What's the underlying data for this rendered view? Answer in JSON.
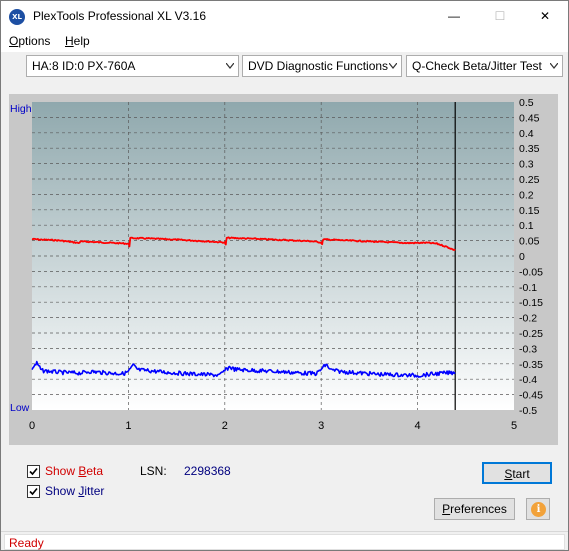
{
  "window": {
    "title": "PlexTools Professional XL V3.16",
    "icon_text": "XL",
    "minimize_glyph": "—",
    "maximize_glyph": "☐",
    "close_glyph": "✕"
  },
  "menu": {
    "options": {
      "accel": "O",
      "rest": "ptions"
    },
    "help": {
      "accel": "H",
      "rest": "elp"
    }
  },
  "toolbar": {
    "drive_select": "HA:8 ID:0  PX-760A",
    "function_select": "DVD Diagnostic Functions",
    "test_select": "Q-Check Beta/Jitter Test"
  },
  "chart_data": {
    "type": "line",
    "left_axis_labels": {
      "top": "High",
      "bottom": "Low"
    },
    "x": {
      "min": 0,
      "max": 5,
      "ticks": [
        "0",
        "1",
        "2",
        "3",
        "4",
        "5"
      ]
    },
    "y_right": {
      "min": -0.5,
      "max": 0.5,
      "ticks": [
        "0.5",
        "0.45",
        "0.4",
        "0.35",
        "0.3",
        "0.25",
        "0.2",
        "0.15",
        "0.1",
        "0.05",
        "0",
        "-0.05",
        "-0.1",
        "-0.15",
        "-0.2",
        "-0.25",
        "-0.3",
        "-0.35",
        "-0.4",
        "-0.45",
        "-0.5"
      ]
    },
    "grid": true,
    "end_marker_x": 4.39,
    "colors": {
      "beta": "#ff0000",
      "jitter": "#0000ff",
      "plot_top": "#8fa8ad",
      "plot_bottom": "#ffffff"
    },
    "series": [
      {
        "key": "beta",
        "x": [
          0,
          0.1,
          0.2,
          0.3,
          0.4,
          0.49,
          0.5,
          0.6,
          0.8,
          1.0,
          1.01,
          1.02,
          1.2,
          1.5,
          1.8,
          2.0,
          2.01,
          2.02,
          2.3,
          2.6,
          2.9,
          3.0,
          3.01,
          3.02,
          3.3,
          3.6,
          3.9,
          4.1,
          4.2,
          4.3,
          4.39
        ],
        "y": [
          0.055,
          0.053,
          0.052,
          0.05,
          0.046,
          0.042,
          0.047,
          0.046,
          0.043,
          0.04,
          0.032,
          0.058,
          0.057,
          0.053,
          0.048,
          0.044,
          0.036,
          0.059,
          0.056,
          0.052,
          0.048,
          0.044,
          0.038,
          0.054,
          0.05,
          0.046,
          0.042,
          0.043,
          0.04,
          0.03,
          0.018
        ]
      },
      {
        "key": "jitter",
        "x": [
          0,
          0.05,
          0.1,
          0.2,
          0.3,
          0.5,
          0.6,
          0.8,
          0.95,
          1.0,
          1.05,
          1.1,
          1.2,
          1.4,
          1.6,
          1.8,
          1.95,
          2.0,
          2.05,
          2.1,
          2.2,
          2.4,
          2.6,
          2.8,
          2.95,
          3.0,
          3.05,
          3.1,
          3.2,
          3.4,
          3.6,
          3.8,
          4.0,
          4.2,
          4.39
        ],
        "y": [
          -0.365,
          -0.348,
          -0.372,
          -0.375,
          -0.378,
          -0.38,
          -0.375,
          -0.38,
          -0.382,
          -0.375,
          -0.355,
          -0.37,
          -0.372,
          -0.378,
          -0.382,
          -0.385,
          -0.387,
          -0.372,
          -0.36,
          -0.368,
          -0.37,
          -0.373,
          -0.376,
          -0.38,
          -0.382,
          -0.368,
          -0.352,
          -0.37,
          -0.375,
          -0.38,
          -0.384,
          -0.386,
          -0.388,
          -0.382,
          -0.378
        ]
      }
    ]
  },
  "controls": {
    "show_beta": {
      "pre": "Show ",
      "accel": "B",
      "post": "eta",
      "checked": true,
      "color": "#d00000"
    },
    "show_jitter": {
      "pre": "Show ",
      "accel": "J",
      "post": "itter",
      "checked": true,
      "color": "#00007f"
    },
    "lsn_label": "LSN:",
    "lsn_value": "2298368",
    "start": {
      "accel": "S",
      "rest": "tart"
    },
    "preferences": {
      "accel": "P",
      "rest": "references"
    },
    "info_glyph": "i"
  },
  "status": {
    "text": "Ready"
  }
}
